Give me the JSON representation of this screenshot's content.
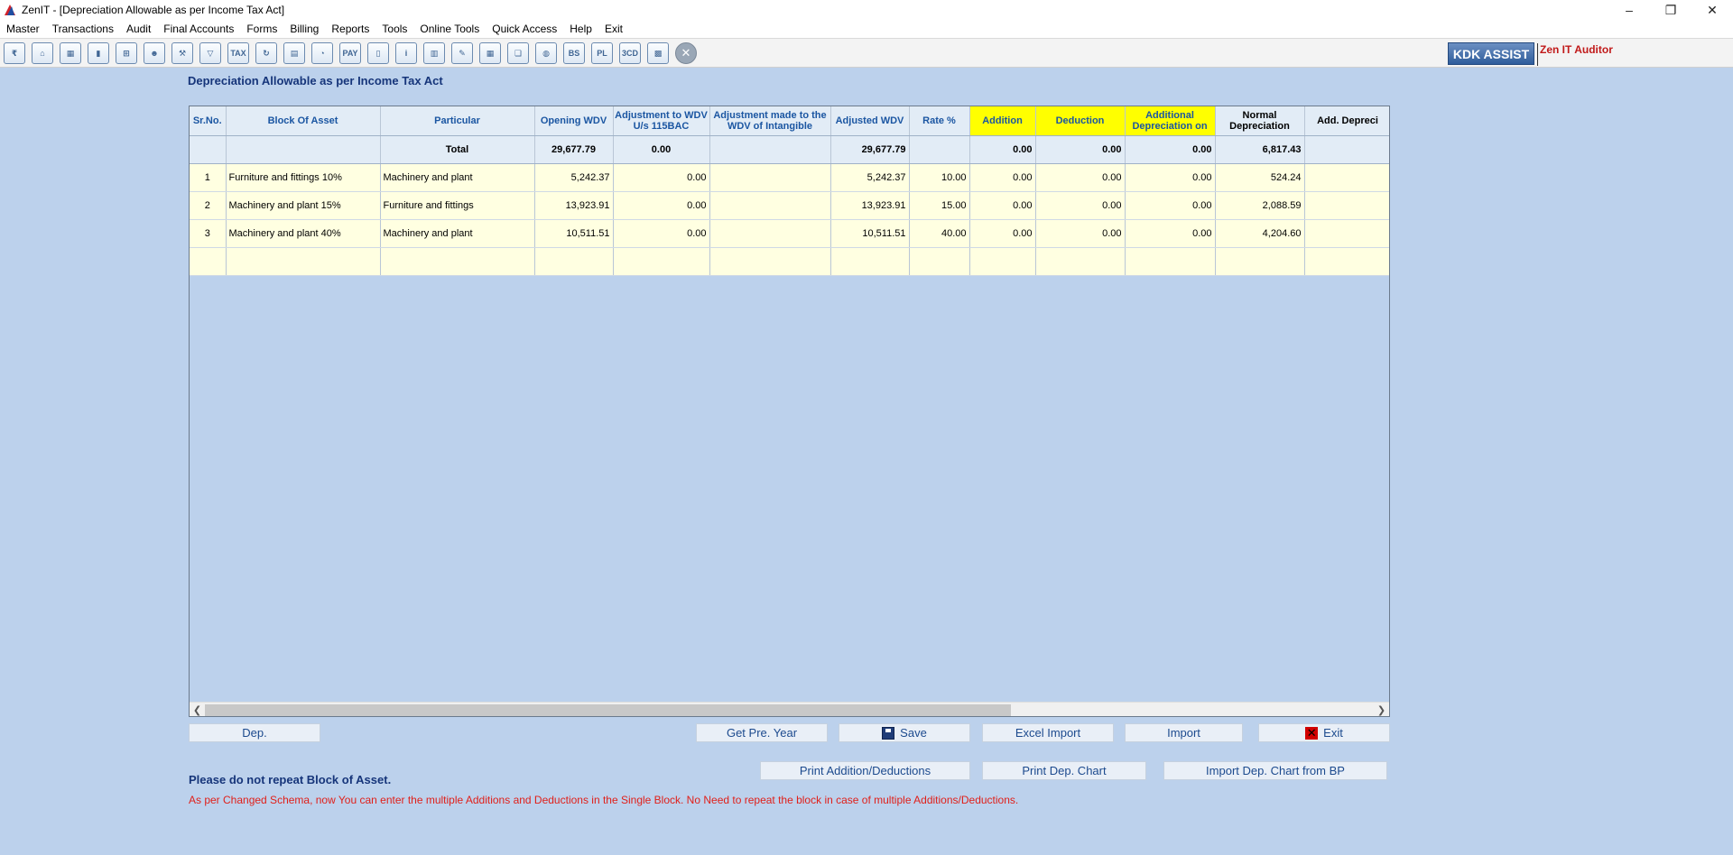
{
  "window": {
    "title": "ZenIT - [Depreciation Allowable as per Income Tax Act]"
  },
  "menu": [
    "Master",
    "Transactions",
    "Audit",
    "Final Accounts",
    "Forms",
    "Billing",
    "Reports",
    "Tools",
    "Online Tools",
    "Quick Access",
    "Help",
    "Exit"
  ],
  "toolbar": {
    "icons": [
      {
        "name": "rupee-icon",
        "glyph": "₹"
      },
      {
        "name": "home-icon",
        "glyph": "⌂"
      },
      {
        "name": "building-icon",
        "glyph": "▦"
      },
      {
        "name": "bar-chart-icon",
        "glyph": "▮"
      },
      {
        "name": "gift-icon",
        "glyph": "⊞"
      },
      {
        "name": "users-icon",
        "glyph": "☻"
      },
      {
        "name": "hammer-icon",
        "glyph": "⚒"
      },
      {
        "name": "filter-icon",
        "glyph": "▽"
      },
      {
        "name": "tax-icon",
        "glyph": "TAX"
      },
      {
        "name": "refresh-icon",
        "glyph": "↻"
      },
      {
        "name": "calculator-icon",
        "glyph": "▤"
      },
      {
        "name": "pie-icon",
        "glyph": "◔"
      },
      {
        "name": "pay-icon",
        "glyph": "PAY"
      },
      {
        "name": "book-icon",
        "glyph": "▯"
      },
      {
        "name": "info-icon",
        "glyph": "i"
      },
      {
        "name": "report-icon",
        "glyph": "▥"
      },
      {
        "name": "edit-doc-icon",
        "glyph": "✎"
      },
      {
        "name": "calendar-icon",
        "glyph": "▦"
      },
      {
        "name": "folder-icon",
        "glyph": "❏"
      },
      {
        "name": "globe-icon",
        "glyph": "◍"
      },
      {
        "name": "bs-icon",
        "glyph": "BS"
      },
      {
        "name": "pl-icon",
        "glyph": "PL"
      },
      {
        "name": "3cd-icon",
        "glyph": "3CD"
      },
      {
        "name": "grid-doc-icon",
        "glyph": "▩"
      }
    ],
    "close_glyph": "✕",
    "kdk_label": "KDK ASSIST",
    "zen_label": "Zen IT Auditor"
  },
  "page": {
    "heading": "Depreciation Allowable as per Income Tax Act"
  },
  "table": {
    "headers": [
      "Sr.No.",
      "Block Of Asset",
      "Particular",
      "Opening WDV",
      "Adjustment to WDV U/s 115BAC",
      "Adjustment made to the WDV of Intangible",
      "Adjusted WDV",
      "Rate %",
      "Addition",
      "Deduction",
      "Additional Depreciation on",
      "Normal Depreciation",
      "Add. Depreci"
    ],
    "total": {
      "label": "Total",
      "opening_wdv": "29,677.79",
      "adj_115bac": "0.00",
      "adjusted_wdv": "29,677.79",
      "addition": "0.00",
      "deduction": "0.00",
      "additional_dep": "0.00",
      "normal_dep": "6,817.43"
    },
    "rows": [
      {
        "sr": "1",
        "block": "Furniture and fittings 10%",
        "particular": "Machinery and plant",
        "opening_wdv": "5,242.37",
        "adj_115bac": "0.00",
        "adj_intangible": "",
        "adjusted_wdv": "5,242.37",
        "rate": "10.00",
        "addition": "0.00",
        "deduction": "0.00",
        "additional_dep": "0.00",
        "normal_dep": "524.24",
        "add_dep": ""
      },
      {
        "sr": "2",
        "block": "Machinery and plant 15%",
        "particular": "Furniture and fittings",
        "opening_wdv": "13,923.91",
        "adj_115bac": "0.00",
        "adj_intangible": "",
        "adjusted_wdv": "13,923.91",
        "rate": "15.00",
        "addition": "0.00",
        "deduction": "0.00",
        "additional_dep": "0.00",
        "normal_dep": "2,088.59",
        "add_dep": ""
      },
      {
        "sr": "3",
        "block": "Machinery and plant 40%",
        "particular": "Machinery and plant",
        "opening_wdv": "10,511.51",
        "adj_115bac": "0.00",
        "adj_intangible": "",
        "adjusted_wdv": "10,511.51",
        "rate": "40.00",
        "addition": "0.00",
        "deduction": "0.00",
        "additional_dep": "0.00",
        "normal_dep": "4,204.60",
        "add_dep": ""
      }
    ]
  },
  "buttons": {
    "dep": "Dep.",
    "get_pre_year": "Get Pre. Year",
    "save": "Save",
    "excel_import": "Excel Import",
    "import": "Import",
    "exit": "Exit",
    "print_add_ded": "Print Addition/Deductions",
    "print_dep_chart": "Print Dep. Chart",
    "import_dep_chart_bp": "Import Dep. Chart from BP"
  },
  "notes": {
    "warning": "Please do not repeat Block of Asset.",
    "info": "As per Changed Schema, now You can enter the multiple Additions and Deductions in the Single Block. No Need to repeat the block in case of multiple Additions/Deductions."
  },
  "colors": {
    "background": "#bcd1ec",
    "header_yellow": "#ffff00",
    "row_bg": "#ffffe1",
    "header_text": "#1b56a2",
    "note_red": "#e0201a"
  }
}
